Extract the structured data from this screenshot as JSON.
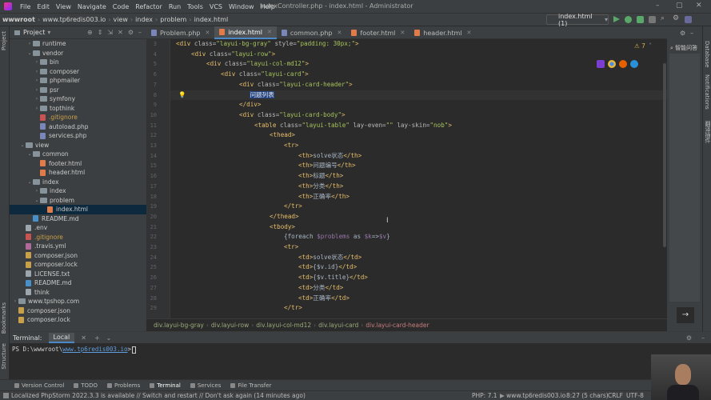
{
  "menubar": {
    "items": [
      "File",
      "Edit",
      "View",
      "Navigate",
      "Code",
      "Refactor",
      "Run",
      "Tools",
      "VCS",
      "Window",
      "Help"
    ],
    "window_title": "IndexController.php - index.html - Administrator"
  },
  "navbar": {
    "crumbs": [
      "wwwroot",
      "www.tp6redis003.io",
      "view",
      "index",
      "problem",
      "index.html"
    ],
    "run_config": "index.html (1)"
  },
  "project": {
    "title": "Project",
    "tree": [
      {
        "label": "runtime",
        "indent": 3,
        "type": "folder",
        "arrow": "›"
      },
      {
        "label": "vendor",
        "indent": 3,
        "type": "folder",
        "arrow": "⌄"
      },
      {
        "label": "bin",
        "indent": 4,
        "type": "folder",
        "arrow": "›"
      },
      {
        "label": "composer",
        "indent": 4,
        "type": "folder",
        "arrow": "›"
      },
      {
        "label": "phpmailer",
        "indent": 4,
        "type": "folder",
        "arrow": "›"
      },
      {
        "label": "psr",
        "indent": 4,
        "type": "folder",
        "arrow": "›"
      },
      {
        "label": "symfony",
        "indent": 4,
        "type": "folder",
        "arrow": "›"
      },
      {
        "label": "topthink",
        "indent": 4,
        "type": "folder",
        "arrow": "›"
      },
      {
        "label": ".gitignore",
        "indent": 4,
        "type": "git",
        "arrow": ""
      },
      {
        "label": "autoload.php",
        "indent": 4,
        "type": "php",
        "arrow": ""
      },
      {
        "label": "services.php",
        "indent": 4,
        "type": "php",
        "arrow": ""
      },
      {
        "label": "view",
        "indent": 2,
        "type": "folder",
        "arrow": "⌄"
      },
      {
        "label": "common",
        "indent": 3,
        "type": "folder",
        "arrow": "⌄"
      },
      {
        "label": "footer.html",
        "indent": 4,
        "type": "html",
        "arrow": ""
      },
      {
        "label": "header.html",
        "indent": 4,
        "type": "html",
        "arrow": ""
      },
      {
        "label": "index",
        "indent": 3,
        "type": "folder",
        "arrow": "⌄"
      },
      {
        "label": "index",
        "indent": 4,
        "type": "folder",
        "arrow": "›"
      },
      {
        "label": "problem",
        "indent": 4,
        "type": "folder",
        "arrow": "⌄"
      },
      {
        "label": "index.html",
        "indent": 5,
        "type": "html",
        "arrow": "",
        "selected": true
      },
      {
        "label": "README.md",
        "indent": 3,
        "type": "md",
        "arrow": ""
      },
      {
        "label": ".env",
        "indent": 2,
        "type": "txt",
        "arrow": ""
      },
      {
        "label": ".gitignore",
        "indent": 2,
        "type": "git",
        "arrow": ""
      },
      {
        "label": ".travis.yml",
        "indent": 2,
        "type": "yml",
        "arrow": ""
      },
      {
        "label": "composer.json",
        "indent": 2,
        "type": "json",
        "arrow": ""
      },
      {
        "label": "composer.lock",
        "indent": 2,
        "type": "json",
        "arrow": ""
      },
      {
        "label": "LICENSE.txt",
        "indent": 2,
        "type": "txt",
        "arrow": ""
      },
      {
        "label": "README.md",
        "indent": 2,
        "type": "md",
        "arrow": ""
      },
      {
        "label": "think",
        "indent": 2,
        "type": "txt",
        "arrow": ""
      },
      {
        "label": "www.tpshop.com",
        "indent": 1,
        "type": "folder",
        "arrow": "›"
      },
      {
        "label": "composer.json",
        "indent": 1,
        "type": "json",
        "arrow": ""
      },
      {
        "label": "composer.lock",
        "indent": 1,
        "type": "json",
        "arrow": ""
      }
    ]
  },
  "tabs": [
    {
      "label": "Problem.php",
      "type": "php"
    },
    {
      "label": "index.html",
      "type": "html",
      "active": true
    },
    {
      "label": "common.php",
      "type": "php"
    },
    {
      "label": "footer.html",
      "type": "html"
    },
    {
      "label": "header.html",
      "type": "html"
    }
  ],
  "editor": {
    "line_numbers": [
      "3",
      "4",
      "5",
      "6",
      "7",
      "8",
      "9",
      "10",
      "11",
      "12",
      "13",
      "14",
      "15",
      "16",
      "17",
      "18",
      "19",
      "20",
      "21",
      "22",
      "23",
      "24",
      "25",
      "26",
      "27",
      "28",
      "29"
    ],
    "inspection_count": "7",
    "breadcrumb": [
      "div.layui-bg-gray",
      "div.layui-row",
      "div.layui-col-md12",
      "div.layui-card",
      "div.layui-card-header"
    ]
  },
  "right_strip": {
    "labels": [
      "Database",
      "Notifications",
      "翻译插件"
    ],
    "panel_text": "智能问答"
  },
  "terminal": {
    "title": "Terminal:",
    "tab": "Local",
    "prompt_prefix": "PS D:\\wwwroot\\",
    "prompt_link": "www.tp6redis003.io",
    "prompt_suffix": ">"
  },
  "left_strip": {
    "labels": [
      "Project",
      "Bookmarks",
      "Structure"
    ]
  },
  "toolwindows": [
    "Version Control",
    "TODO",
    "Problems",
    "Terminal",
    "Services",
    "File Transfer"
  ],
  "status": {
    "message": "Localized PhpStorm 2022.3.3 is available // Switch and restart // Don't ask again (14 minutes ago)",
    "php": "PHP: 7.1",
    "project": "www.tp6redis003.io",
    "position": "8:27 (5 chars)",
    "line_sep": "CRLF",
    "encoding": "UTF-8"
  }
}
